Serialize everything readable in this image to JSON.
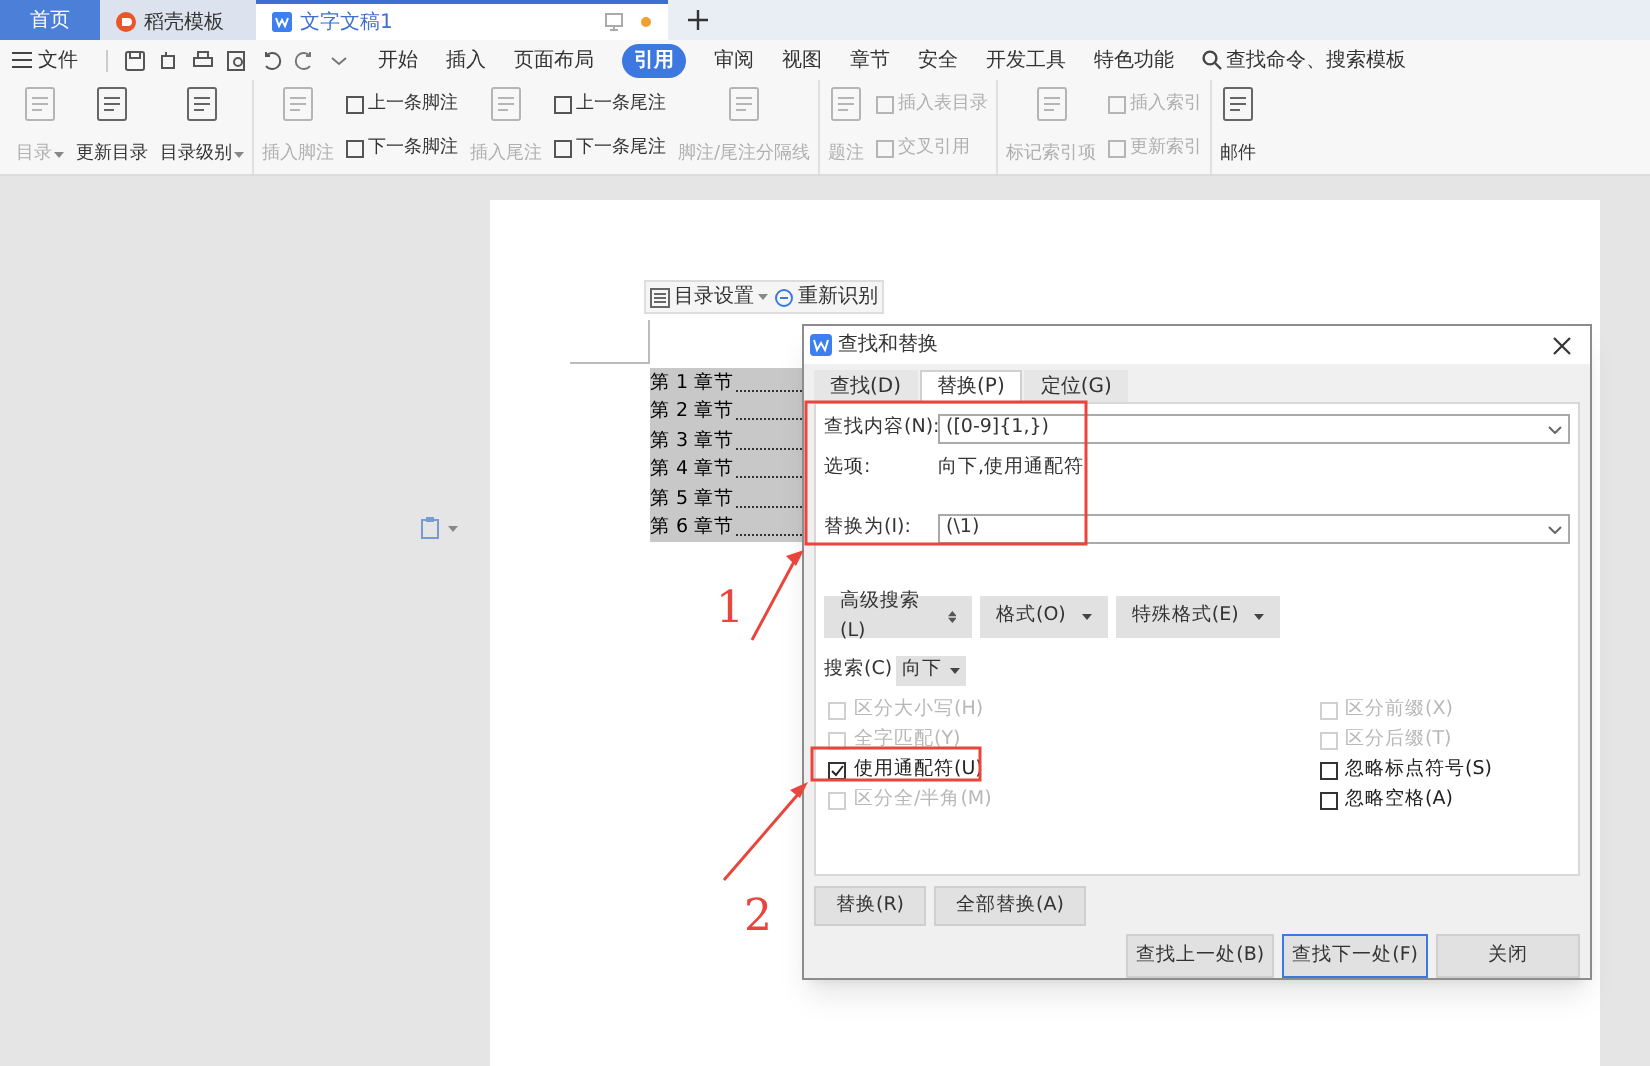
{
  "tabs": [
    {
      "label": "首页",
      "selected": false,
      "kind": "home"
    },
    {
      "label": "稻壳模板",
      "selected": false,
      "kind": "docer"
    },
    {
      "label": "文字文稿1",
      "selected": true,
      "kind": "doc"
    }
  ],
  "menu": {
    "file": "文件",
    "items": [
      {
        "label": "开始",
        "selected": false
      },
      {
        "label": "插入",
        "selected": false
      },
      {
        "label": "页面布局",
        "selected": false
      },
      {
        "label": "引用",
        "selected": true
      },
      {
        "label": "审阅",
        "selected": false
      },
      {
        "label": "视图",
        "selected": false
      },
      {
        "label": "章节",
        "selected": false
      },
      {
        "label": "安全",
        "selected": false
      },
      {
        "label": "开发工具",
        "selected": false
      },
      {
        "label": "特色功能",
        "selected": false
      }
    ],
    "search_placeholder": "查找命令、搜索模板"
  },
  "ribbon": [
    {
      "items": [
        {
          "kind": "large",
          "label": "目录",
          "disabled": true,
          "dropdown": true
        },
        {
          "kind": "large",
          "label": "更新目录",
          "disabled": false,
          "dropdown": false
        },
        {
          "kind": "large",
          "label": "目录级别",
          "disabled": false,
          "dropdown": true
        }
      ]
    },
    {
      "items": [
        {
          "kind": "large",
          "label": "插入脚注",
          "disabled": true,
          "dropdown": false
        },
        {
          "kind": "stack",
          "items": [
            {
              "label": "上一条脚注",
              "disabled": false
            },
            {
              "label": "下一条脚注",
              "disabled": false
            }
          ]
        },
        {
          "kind": "large",
          "label": "插入尾注",
          "disabled": true,
          "dropdown": false
        },
        {
          "kind": "stack",
          "items": [
            {
              "label": "上一条尾注",
              "disabled": false
            },
            {
              "label": "下一条尾注",
              "disabled": false
            }
          ]
        },
        {
          "kind": "large",
          "label": "脚注/尾注分隔线",
          "disabled": true,
          "dropdown": false
        }
      ]
    },
    {
      "items": [
        {
          "kind": "large",
          "label": "题注",
          "disabled": true,
          "dropdown": false
        },
        {
          "kind": "stack",
          "items": [
            {
              "label": "插入表目录",
              "disabled": true
            },
            {
              "label": "交叉引用",
              "disabled": true
            }
          ]
        }
      ]
    },
    {
      "items": [
        {
          "kind": "large",
          "label": "标记索引项",
          "disabled": true,
          "dropdown": false
        },
        {
          "kind": "stack",
          "items": [
            {
              "label": "插入索引",
              "disabled": true
            },
            {
              "label": "更新索引",
              "disabled": true
            }
          ]
        }
      ]
    },
    {
      "items": [
        {
          "kind": "large",
          "label": "邮件",
          "disabled": false,
          "dropdown": false
        }
      ]
    }
  ],
  "document": {
    "toc_toolbar": [
      "目录设置",
      "重新识别"
    ],
    "toc_entries": [
      "第 1 章节",
      "第 2 章节",
      "第 3 章节",
      "第 4 章节",
      "第 5 章节",
      "第 6 章节"
    ]
  },
  "dialog": {
    "title": "查找和替换",
    "tabs": [
      {
        "label": "查找(D)",
        "selected": false
      },
      {
        "label": "替换(P)",
        "selected": true
      },
      {
        "label": "定位(G)",
        "selected": false
      }
    ],
    "find_label": "查找内容(N):",
    "find_value": "([0-9]{1,})",
    "options_label": "选项:",
    "options_value": "向下,使用通配符",
    "replace_label": "替换为(I):",
    "replace_value": "(\\1)",
    "option_buttons": [
      {
        "label": "高级搜索(L)",
        "kind": "toggle"
      },
      {
        "label": "格式(O)",
        "kind": "menu"
      },
      {
        "label": "特殊格式(E)",
        "kind": "menu"
      }
    ],
    "search_label": "搜索(C)",
    "search_value": "向下",
    "checkboxes_left": [
      {
        "label": "区分大小写(H)",
        "checked": false,
        "disabled": true
      },
      {
        "label": "全字匹配(Y)",
        "checked": false,
        "disabled": true
      },
      {
        "label": "使用通配符(U)",
        "checked": true,
        "disabled": false
      },
      {
        "label": "区分全/半角(M)",
        "checked": false,
        "disabled": true
      }
    ],
    "checkboxes_right": [
      {
        "label": "区分前缀(X)",
        "checked": false,
        "disabled": true
      },
      {
        "label": "区分后缀(T)",
        "checked": false,
        "disabled": true
      },
      {
        "label": "忽略标点符号(S)",
        "checked": false,
        "disabled": false
      },
      {
        "label": "忽略空格(A)",
        "checked": false,
        "disabled": false
      }
    ],
    "replace_buttons": [
      "替换(R)",
      "全部替换(A)"
    ],
    "bottom_buttons": [
      {
        "label": "查找上一处(B)",
        "focused": false
      },
      {
        "label": "查找下一处(F)",
        "focused": true
      },
      {
        "label": "关闭",
        "focused": false
      }
    ]
  },
  "annotations": [
    {
      "label": "1"
    },
    {
      "label": "2"
    }
  ]
}
